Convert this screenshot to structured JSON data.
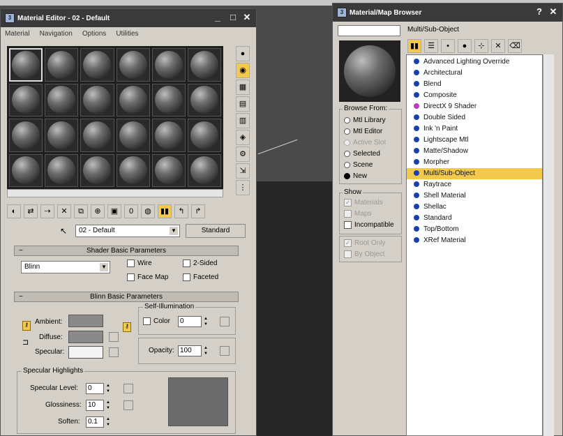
{
  "material_editor": {
    "title": "Material Editor - 02 - Default",
    "menu": [
      "Material",
      "Navigation",
      "Options",
      "Utilities"
    ],
    "material_name": "02 - Default",
    "type_button": "Standard",
    "shader_rollout": {
      "title": "Shader Basic Parameters",
      "shader": "Blinn",
      "wire": "Wire",
      "two_sided": "2-Sided",
      "face_map": "Face Map",
      "faceted": "Faceted"
    },
    "blinn_rollout": {
      "title": "Blinn Basic Parameters",
      "self_illum_label": "Self-Illumination",
      "color_label": "Color",
      "color_value": "0",
      "ambient": "Ambient:",
      "diffuse": "Diffuse:",
      "specular": "Specular:",
      "opacity_label": "Opacity:",
      "opacity_value": "100",
      "spec_highlights": "Specular Highlights",
      "spec_level_label": "Specular Level:",
      "spec_level_value": "0",
      "glossiness_label": "Glossiness:",
      "glossiness_value": "10",
      "soften_label": "Soften:",
      "soften_value": "0.1"
    },
    "colors": {
      "ambient": "#8a8a8a",
      "diffuse": "#8a8a8a",
      "specular": "#f4f4f4",
      "highlight_preview": "#6b6b6b"
    }
  },
  "browser": {
    "title": "Material/Map Browser",
    "search_value": "",
    "selected_name": "Multi/Sub-Object",
    "browse_from_label": "Browse From:",
    "browse_from": [
      {
        "label": "Mtl Library",
        "state": "off"
      },
      {
        "label": "Mtl Editor",
        "state": "off"
      },
      {
        "label": "Active Slot",
        "state": "disabled"
      },
      {
        "label": "Selected",
        "state": "off"
      },
      {
        "label": "Scene",
        "state": "off"
      },
      {
        "label": "New",
        "state": "on"
      }
    ],
    "show_label": "Show",
    "show": [
      {
        "label": "Materials",
        "state": "disabled-checked"
      },
      {
        "label": "Maps",
        "state": "disabled"
      },
      {
        "label": "Incompatible",
        "state": "off"
      }
    ],
    "root_only": "Root Only",
    "by_object": "By Object",
    "materials": [
      "Advanced Lighting Override",
      "Architectural",
      "Blend",
      "Composite",
      "DirectX 9 Shader",
      "Double Sided",
      "Ink 'n Paint",
      "Lightscape Mtl",
      "Matte/Shadow",
      "Morpher",
      "Multi/Sub-Object",
      "Raytrace",
      "Shell Material",
      "Shellac",
      "Standard",
      "Top/Bottom",
      "XRef Material"
    ]
  }
}
